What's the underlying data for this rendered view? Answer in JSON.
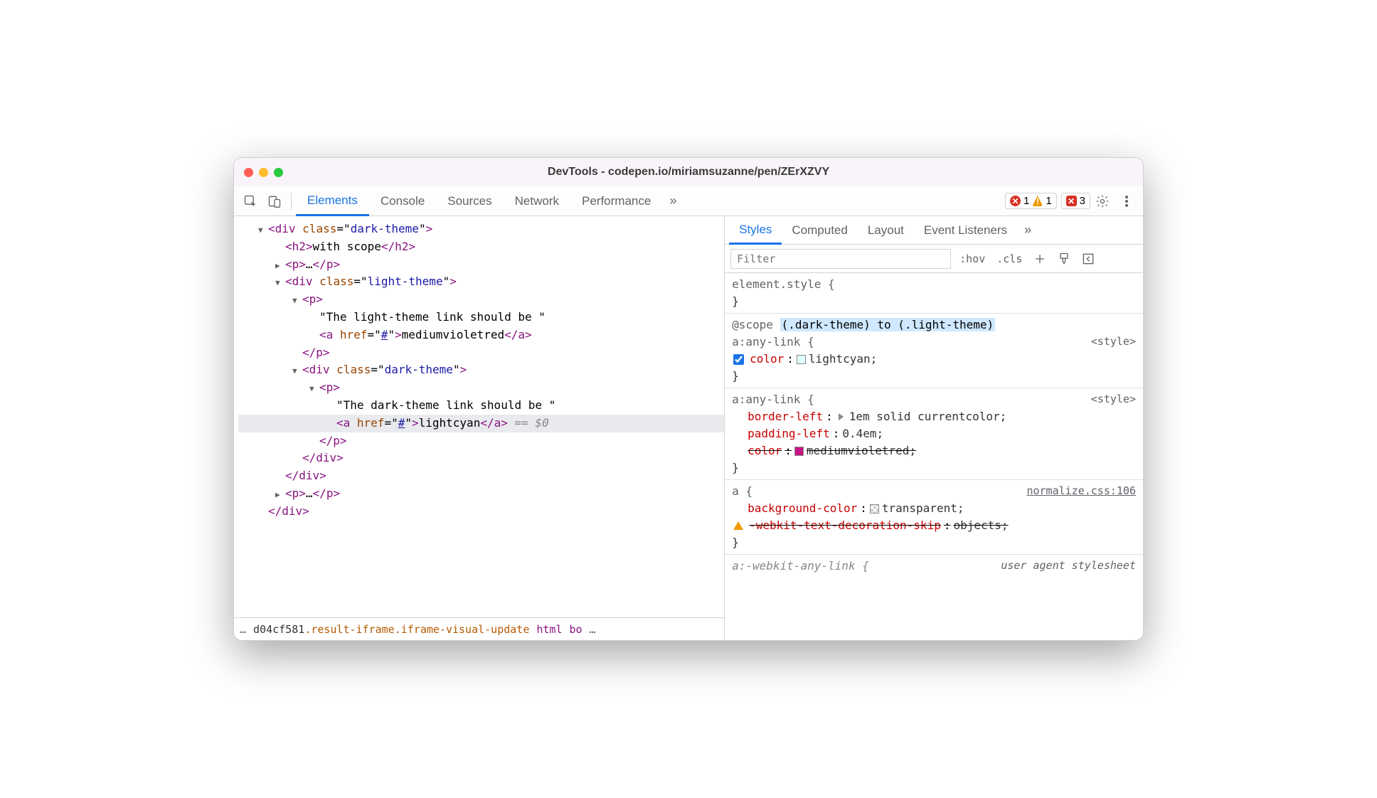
{
  "window": {
    "title": "DevTools - codepen.io/miriamsuzanne/pen/ZErXZVY"
  },
  "toolbar": {
    "tabs": [
      "Elements",
      "Console",
      "Sources",
      "Network",
      "Performance"
    ],
    "more": "»",
    "errors": "1",
    "warnings": "1",
    "issues": "3"
  },
  "dom": {
    "lines": [
      {
        "indent": 2,
        "arrow": "down",
        "html": "<span class='tag'>&lt;div</span> <span class='attr-name'>class</span>=\"<span class='attr-val'>dark-theme</span>\"<span class='tag'>&gt;</span>"
      },
      {
        "indent": 4,
        "html": "<span class='tag'>&lt;h2&gt;</span><span class='txt'>with scope</span><span class='tag'>&lt;/h2&gt;</span>"
      },
      {
        "indent": 4,
        "arrow": "right",
        "html": "<span class='tag'>&lt;p&gt;</span><span class='ellipsis'>…</span><span class='tag'>&lt;/p&gt;</span>"
      },
      {
        "indent": 4,
        "arrow": "down",
        "html": "<span class='tag'>&lt;div</span> <span class='attr-name'>class</span>=\"<span class='attr-val'>light-theme</span>\"<span class='tag'>&gt;</span>"
      },
      {
        "indent": 6,
        "arrow": "down",
        "html": "<span class='tag'>&lt;p&gt;</span>"
      },
      {
        "indent": 8,
        "html": "<span class='txt'>\"The light-theme link should be \"</span>"
      },
      {
        "indent": 8,
        "html": "<span class='tag'>&lt;a</span> <span class='attr-name'>href</span>=\"<span class='attr-link'>#</span>\"<span class='tag'>&gt;</span><span class='txt'>mediumvioletred</span><span class='tag'>&lt;/a&gt;</span>"
      },
      {
        "indent": 6,
        "html": "<span class='tag'>&lt;/p&gt;</span>"
      },
      {
        "indent": 6,
        "arrow": "down",
        "html": "<span class='tag'>&lt;div</span> <span class='attr-name'>class</span>=\"<span class='attr-val'>dark-theme</span>\"<span class='tag'>&gt;</span>"
      },
      {
        "indent": 8,
        "arrow": "down",
        "html": "<span class='tag'>&lt;p&gt;</span>"
      },
      {
        "indent": 10,
        "html": "<span class='txt'>\"The dark-theme link should be \"</span>"
      },
      {
        "indent": 10,
        "selected": true,
        "html": "<span class='tag'>&lt;a</span> <span class='attr-name'>href</span>=\"<span class='attr-link'>#</span>\"<span class='tag'>&gt;</span><span class='txt'>lightcyan</span><span class='tag'>&lt;/a&gt;</span> <span class='sel-hint'>== $0</span>"
      },
      {
        "indent": 8,
        "html": "<span class='tag'>&lt;/p&gt;</span>"
      },
      {
        "indent": 6,
        "html": "<span class='tag'>&lt;/div&gt;</span>"
      },
      {
        "indent": 4,
        "html": "<span class='tag'>&lt;/div&gt;</span>"
      },
      {
        "indent": 4,
        "arrow": "right",
        "html": "<span class='tag'>&lt;p&gt;</span><span class='ellipsis'>…</span><span class='tag'>&lt;/p&gt;</span>"
      },
      {
        "indent": 2,
        "html": "<span class='tag'>&lt;/div&gt;</span>"
      }
    ]
  },
  "breadcrumb": {
    "prefix": "…",
    "iframe_id": "d04cf581",
    "iframe_class": ".result-iframe.iframe-visual-update",
    "items": [
      "html",
      "bo"
    ],
    "suffix": "…"
  },
  "subtabs": [
    "Styles",
    "Computed",
    "Layout",
    "Event Listeners"
  ],
  "subtabs_more": "»",
  "filter": {
    "placeholder": "Filter",
    "hov": ":hov",
    "cls": ".cls"
  },
  "styles": {
    "element_style": {
      "selector": "element.style {",
      "close": "}"
    },
    "rule1": {
      "scope_prefix": "@scope",
      "scope_text": "(.dark-theme) to (.light-theme)",
      "selector": "a:any-link {",
      "source": "<style>",
      "prop_name": "color",
      "prop_val": "lightcyan;",
      "swatch": "#e0ffff",
      "close": "}"
    },
    "rule2": {
      "selector": "a:any-link {",
      "source": "<style>",
      "p1_name": "border-left",
      "p1_val": "1em solid currentcolor;",
      "p2_name": "padding-left",
      "p2_val": "0.4em;",
      "p3_name": "color",
      "p3_val": "mediumvioletred;",
      "p3_swatch": "#c71585",
      "close": "}"
    },
    "rule3": {
      "selector": "a {",
      "source": "normalize.css:106",
      "p1_name": "background-color",
      "p1_val": "transparent;",
      "p2_name": "-webkit-text-decoration-skip",
      "p2_val": "objects;",
      "close": "}"
    },
    "rule4": {
      "selector": "a:-webkit-any-link {",
      "source": "user agent stylesheet"
    }
  }
}
